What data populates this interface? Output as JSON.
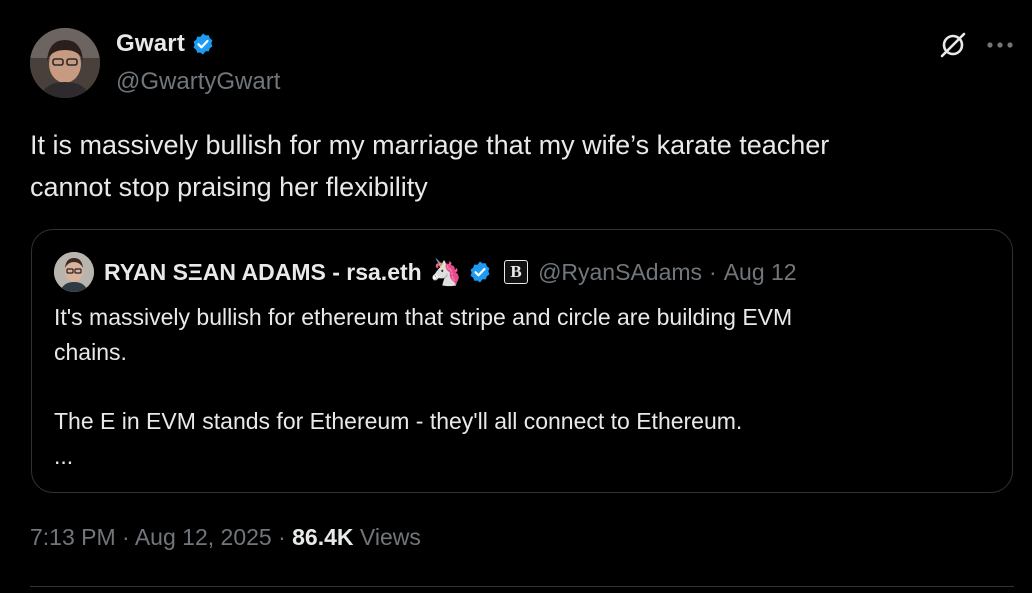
{
  "tweet": {
    "author": {
      "name": "Gwart",
      "handle": "@GwartyGwart",
      "verified": true
    },
    "text_lines": [
      "It is massively bullish for my marriage that my wife’s karate teacher",
      "cannot stop praising her flexibility"
    ],
    "quote": {
      "name": "RYAN SΞAN ADAMS - rsa.eth",
      "emoji": "🦄",
      "affiliate_badge": "B",
      "handle": "@RyanSAdams",
      "separator": "·",
      "date": "Aug 12",
      "body_lines": [
        "It's massively bullish for ethereum that stripe and circle are building EVM",
        "chains.",
        "",
        "The E in EVM stands for Ethereum - they'll all connect to Ethereum.",
        "..."
      ]
    },
    "meta": {
      "time": "7:13 PM",
      "separator": "·",
      "date": "Aug 12, 2025",
      "views_count": "86.4K",
      "views_label": "Views"
    }
  },
  "colors": {
    "background": "#000000",
    "text_primary": "#e7e9ea",
    "text_secondary": "#71767b",
    "verified_blue": "#1d9bf0",
    "border": "#2f3336"
  },
  "icons": {
    "verified": "verified-badge-icon",
    "grok": "grok-icon",
    "more": "more-options-icon"
  }
}
